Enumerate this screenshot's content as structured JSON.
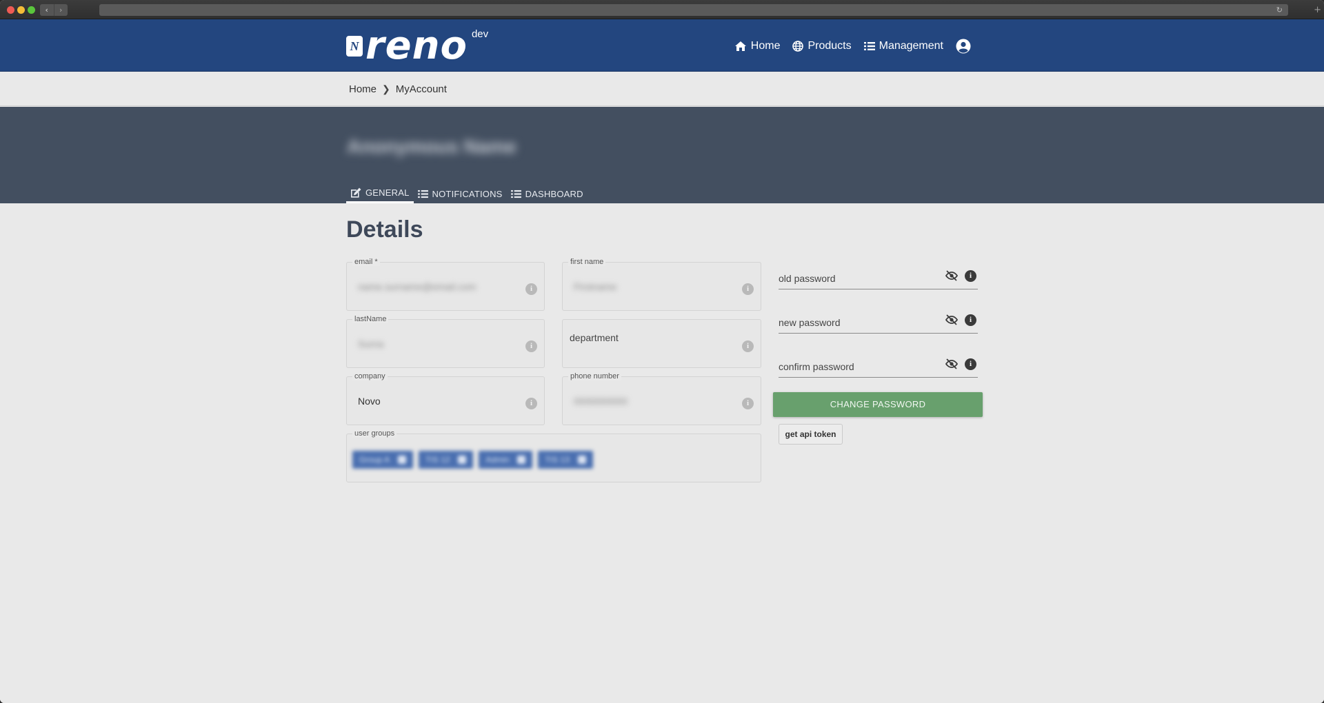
{
  "header": {
    "logo_text": "reno",
    "logo_badge": "N",
    "env": "dev",
    "nav": [
      {
        "label": "Home",
        "icon": "home-icon"
      },
      {
        "label": "Products",
        "icon": "globe-icon"
      },
      {
        "label": "Management",
        "icon": "list-icon"
      }
    ],
    "account_icon": "user-circle-icon"
  },
  "breadcrumb": {
    "items": [
      "Home",
      "MyAccount"
    ],
    "separator": "❯"
  },
  "account": {
    "username": "Anonymous Name",
    "tabs": [
      {
        "label": "GENERAL",
        "icon": "edit-icon",
        "active": true
      },
      {
        "label": "NOTIFICATIONS",
        "icon": "list-icon",
        "active": false
      },
      {
        "label": "DASHBOARD",
        "icon": "list-icon",
        "active": false
      }
    ]
  },
  "details": {
    "title": "Details",
    "fields": {
      "email": {
        "label": "email *",
        "value": "name.surname@email.com"
      },
      "first_name": {
        "label": "first name",
        "value": "Firstname"
      },
      "last_name": {
        "label": "lastName",
        "value": "Surna"
      },
      "department": {
        "placeholder": "department"
      },
      "company": {
        "label": "company",
        "value": "Novo"
      },
      "phone": {
        "label": "phone number",
        "value": "0000000000"
      },
      "user_groups": {
        "label": "user groups",
        "chips": [
          "Group A",
          "TIS 12",
          "Admin",
          "TIS 13"
        ]
      }
    },
    "info_glyph": "i"
  },
  "password": {
    "old_placeholder": "old password",
    "new_placeholder": "new password",
    "confirm_placeholder": "confirm password",
    "change_label": "CHANGE PASSWORD",
    "token_label": "get api token",
    "eye_icon": "eye-slash-icon",
    "info_glyph": "i"
  },
  "colors": {
    "header": "#23467f",
    "band": "#434f60",
    "change_button": "#68a06d",
    "chip": "#4a6fb0"
  }
}
